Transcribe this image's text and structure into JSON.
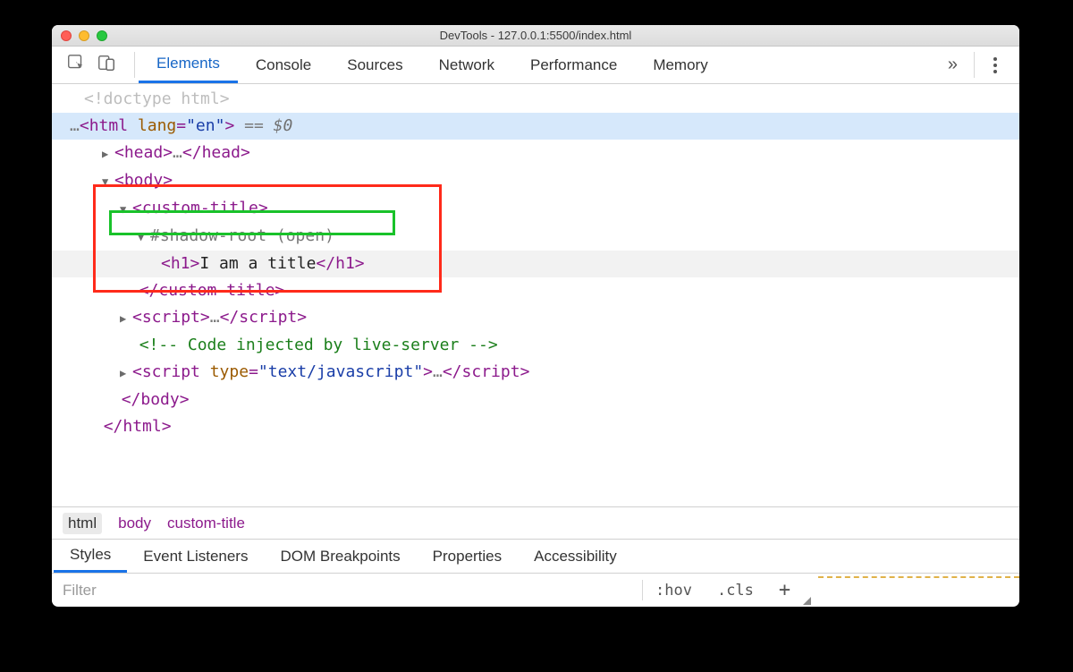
{
  "window": {
    "title": "DevTools - 127.0.0.1:5500/index.html"
  },
  "tabs": [
    "Elements",
    "Console",
    "Sources",
    "Network",
    "Performance",
    "Memory"
  ],
  "more_glyph": "»",
  "dom": {
    "doctype": "<!doctype html>",
    "html_open_pre": "…",
    "html_tag": "html",
    "html_attr": "lang",
    "html_val": "\"en\"",
    "eqdollar_pre": " == ",
    "eqdollar": "$0",
    "head_tag": "head",
    "body_tag": "body",
    "custom_tag": "custom-title",
    "shadow": "#shadow-root (open)",
    "h1_tag": "h1",
    "h1_text": "I am a title",
    "script_tag": "script",
    "comment": "<!-- Code injected by live-server -->",
    "script2_attr": "type",
    "script2_val": "\"text/javascript\"",
    "ellipsis": "…"
  },
  "crumbs": [
    "html",
    "body",
    "custom-title"
  ],
  "subtabs": [
    "Styles",
    "Event Listeners",
    "DOM Breakpoints",
    "Properties",
    "Accessibility"
  ],
  "filter": {
    "placeholder": "Filter",
    "hov": ":hov",
    "cls": ".cls",
    "plus": "+"
  }
}
